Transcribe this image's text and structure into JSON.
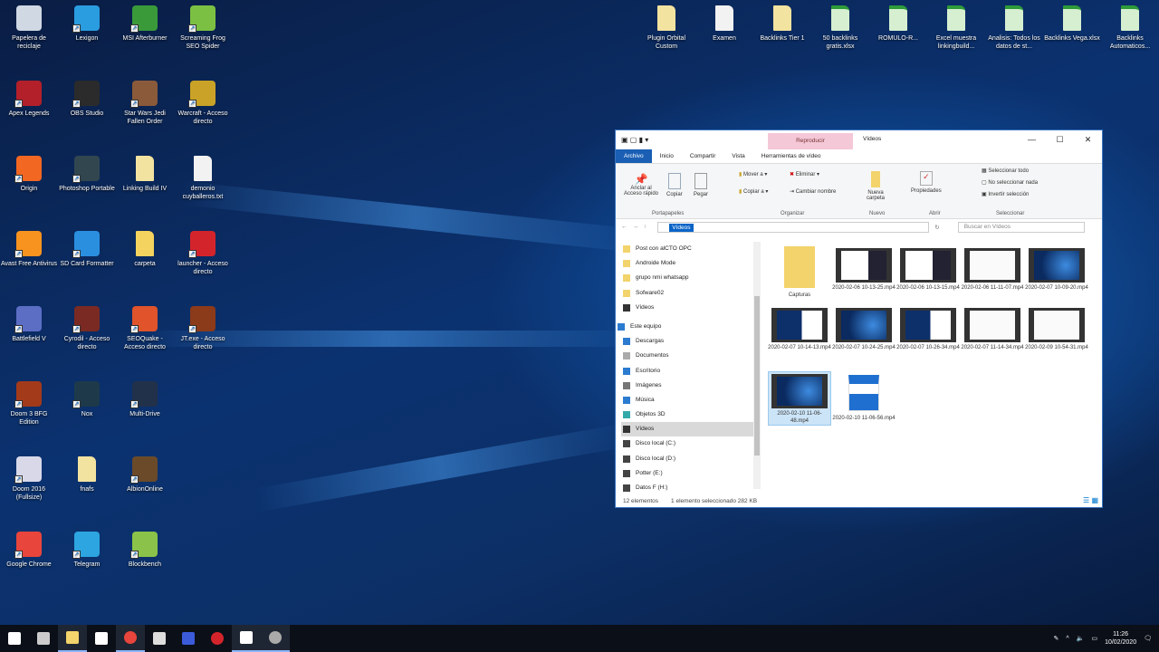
{
  "desktop_left": [
    {
      "label": "Papelera de reciclaje",
      "color": "#cfd8e3"
    },
    {
      "label": "Lexigon",
      "color": "#2a9de0"
    },
    {
      "label": "MSI Afterburner",
      "color": "#3a9a3a"
    },
    {
      "label": "Screaming Frog SEO Spider",
      "color": "#7bc043"
    },
    {
      "label": "Apex Legends",
      "color": "#b3202a"
    },
    {
      "label": "OBS Studio",
      "color": "#2b2b2b"
    },
    {
      "label": "Star Wars Jedi Fallen Order",
      "color": "#8a5a3a"
    },
    {
      "label": "Warcraft - Acceso directo",
      "color": "#c9a227"
    },
    {
      "label": "Origin",
      "color": "#f26722"
    },
    {
      "label": "Photoshop Portable",
      "color": "#31464f"
    },
    {
      "label": "Linking Build IV",
      "color": "#f3e3a0",
      "file": true
    },
    {
      "label": "demonio cuyballeros.txt",
      "color": "#f2f2f2",
      "file": true
    },
    {
      "label": "Avast Free Antivirus",
      "color": "#f7931e"
    },
    {
      "label": "SD Card Formatter",
      "color": "#2b8fe0"
    },
    {
      "label": "carpeta",
      "color": "#f4d35e",
      "file": true
    },
    {
      "label": "launcher - Acceso directo",
      "color": "#d4242b"
    },
    {
      "label": "Battlefield V",
      "color": "#5b6ec4"
    },
    {
      "label": "Cyrodil - Acceso directo",
      "color": "#7a2a22"
    },
    {
      "label": "SEOQuake - Acceso directo",
      "color": "#e0532b"
    },
    {
      "label": "JT.exe - Acceso directo",
      "color": "#8b3a1a"
    },
    {
      "label": "Doom 3 BFG Edition",
      "color": "#a33a1a"
    },
    {
      "label": "Nox",
      "color": "#1e3a4a"
    },
    {
      "label": "Multi-Drive",
      "color": "#22314a"
    },
    null,
    {
      "label": "Doom 2016 (Fullsize)",
      "color": "#d8d8e8"
    },
    {
      "label": "fnafs",
      "color": "#f3e3a0",
      "file": true
    },
    {
      "label": "AlbionOnline",
      "color": "#6b4a2a"
    },
    null,
    {
      "label": "Google Chrome",
      "color": "#e8453c"
    },
    {
      "label": "Telegram",
      "color": "#2ca5e0"
    },
    {
      "label": "Blockbench",
      "color": "#8bc34a"
    },
    null
  ],
  "desktop_right": [
    {
      "label": "Plugin Orbital Custom",
      "color": "#f3e3a0"
    },
    {
      "label": "Examen",
      "color": "#f2f2f2"
    },
    {
      "label": "Backlinks Tier 1",
      "color": "#f3e3a0"
    },
    {
      "label": "50 backlinks gratis.xlsx",
      "color": "#d6efd0"
    },
    {
      "label": "ROMULO-R...",
      "color": "#d6efd0"
    },
    {
      "label": "Excel muestra linkingbuild...",
      "color": "#d6efd0"
    },
    {
      "label": "Analisis: Todos los datos de st...",
      "color": "#d6efd0"
    },
    {
      "label": "Backlinks Vega.xlsx",
      "color": "#d6efd0"
    },
    {
      "label": "Backlinks Automaticos...",
      "color": "#d6efd0"
    }
  ],
  "explorer": {
    "title": "Vídeos",
    "context_tab": "Reproducir",
    "tabs": [
      "Archivo",
      "Inicio",
      "Compartir",
      "Vista",
      "Herramientas de vídeo"
    ],
    "ribbon": {
      "pin": "Anclar al Acceso rápido",
      "copy": "Copiar",
      "paste": "Pegar",
      "move": "Mover a ▾",
      "copyto": "Copiar a ▾",
      "delete": "Eliminar ▾",
      "rename": "Cambiar nombre",
      "newfolder": "Nueva carpeta",
      "properties": "Propiedades",
      "selall": "Seleccionar todo",
      "selnone": "No seleccionar nada",
      "invert": "Invertir selección",
      "groups": [
        "Portapapeles",
        "Organizar",
        "Nuevo",
        "Abrir",
        "Seleccionar"
      ]
    },
    "address": "Vídeos",
    "search_placeholder": "Buscar en Vídeos",
    "nav": [
      {
        "label": "Post con alCTO OPC",
        "icon": "folder"
      },
      {
        "label": "Androide Mode",
        "icon": "folder"
      },
      {
        "label": "grupo nmi whatsapp",
        "icon": "folder"
      },
      {
        "label": "Sofware02",
        "icon": "folder"
      },
      {
        "label": "Vídeos",
        "icon": "video"
      },
      {
        "label": "Este equipo",
        "icon": "pc"
      },
      {
        "label": "Descargas",
        "icon": "download"
      },
      {
        "label": "Documentos",
        "icon": "doc"
      },
      {
        "label": "Escritorio",
        "icon": "desktop"
      },
      {
        "label": "Imágenes",
        "icon": "image"
      },
      {
        "label": "Música",
        "icon": "music"
      },
      {
        "label": "Objetos 3D",
        "icon": "cube"
      },
      {
        "label": "Vídeos",
        "icon": "video",
        "selected": true
      },
      {
        "label": "Disco local (C:)",
        "icon": "drive"
      },
      {
        "label": "Disco local (D:)",
        "icon": "drive"
      },
      {
        "label": "Potter (E:)",
        "icon": "drive"
      },
      {
        "label": "Datos F (H:)",
        "icon": "drive"
      }
    ],
    "files": [
      {
        "name": "Capturas",
        "kind": "folder"
      },
      {
        "name": "2020-02-06 10-13-25.mp4",
        "kind": "light"
      },
      {
        "name": "2020-02-06 10-13-15.mp4",
        "kind": "light"
      },
      {
        "name": "2020-02-06 11-11-07.mp4",
        "kind": "white"
      },
      {
        "name": "2020-02-07 10-09-20.mp4",
        "kind": "dark"
      },
      {
        "name": "2020-02-07 10-14-13.mp4",
        "kind": "mixed"
      },
      {
        "name": "2020-02-07 10-24-25.mp4",
        "kind": "dark"
      },
      {
        "name": "2020-02-07 10-26-34.mp4",
        "kind": "mixed"
      },
      {
        "name": "2020-02-07 11-14-34.mp4",
        "kind": "white"
      },
      {
        "name": "2020-02-09 10-54-31.mp4",
        "kind": "white"
      },
      {
        "name": "2020-02-10 11-06-48.mp4",
        "kind": "dark",
        "selected": true
      },
      {
        "name": "2020-02-10 11-06-56.mp4",
        "kind": "clapper"
      }
    ],
    "status_count": "12 elementos",
    "status_selected": "1 elemento seleccionado 282 KB"
  },
  "taskbar": {
    "apps": [
      "start",
      "task-view",
      "file-explorer",
      "store",
      "chrome",
      "steam",
      "app-blue",
      "opera",
      "mail",
      "settings"
    ],
    "time": "11:26",
    "date": "10/02/2020"
  }
}
